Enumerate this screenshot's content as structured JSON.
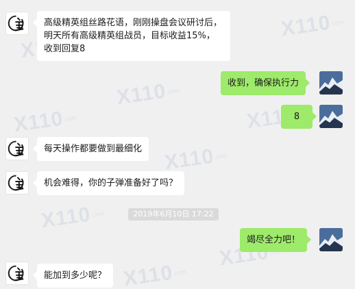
{
  "watermark": {
    "text": "X110",
    "sub": ".com"
  },
  "messages": [
    {
      "side": "left",
      "text": "高级精英组丝路花语，刚刚操盘会议研讨后，明天所有高级精英组战员，目标收益15%，收到回复8"
    },
    {
      "side": "right",
      "text": "收到，确保执行力"
    },
    {
      "side": "right",
      "text": "8"
    },
    {
      "side": "left",
      "text": "每天操作都要做到最细化"
    },
    {
      "side": "left",
      "text": "机会难得，你的子弹准备好了吗？"
    },
    {
      "side": "right",
      "text": "竭尽全力吧！"
    },
    {
      "side": "left",
      "text": "能加到多少呢？"
    }
  ],
  "timestamp": "2019年6月10日 17:22",
  "colors": {
    "background": "#f0f0f0",
    "bubble_left": "#ffffff",
    "bubble_right": "#9eea6a",
    "timestamp_bg": "#dadada"
  },
  "icons": {
    "left_avatar": "calligraphy-avatar-icon",
    "right_avatar": "mountain-avatar-icon"
  }
}
